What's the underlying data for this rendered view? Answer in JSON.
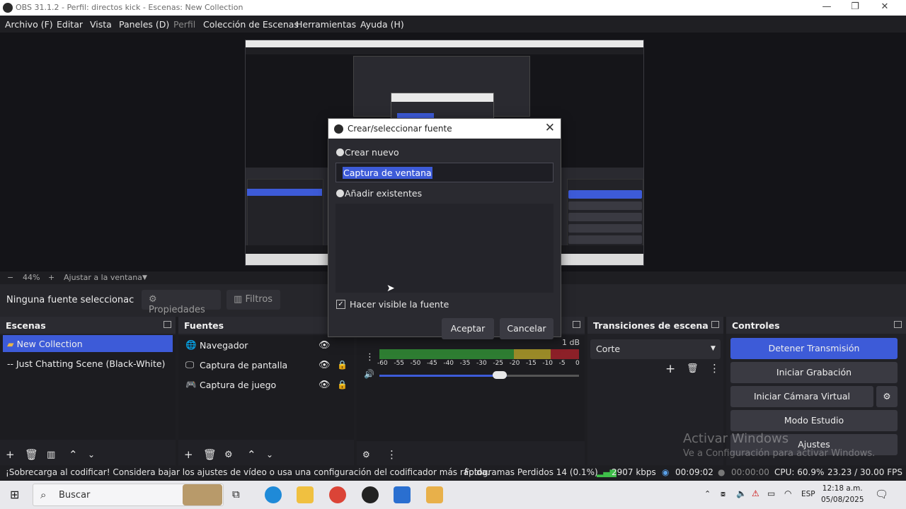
{
  "window": {
    "title": "OBS 31.1.2 - Perfil: directos kick - Escenas: New Collection"
  },
  "menu": [
    "Archivo (F)",
    "Editar",
    "Vista",
    "Paneles (D)",
    "Perfil",
    "Colección de Escenas",
    "Herramientas",
    "Ayuda (H)"
  ],
  "zoom": {
    "minus": "−",
    "value": "44%",
    "plus": "+",
    "fit_label": "Ajustar a la ventana",
    "dropdown": "▼"
  },
  "source_toolbar": {
    "no_selection": "Ninguna fuente seleccionac",
    "properties": "Propiedades",
    "filters": "Filtros"
  },
  "scenes": {
    "title": "Escenas",
    "items": [
      "New Collection",
      "-- Just Chatting Scene (Black-White)"
    ]
  },
  "sources": {
    "title": "Fuentes",
    "items": [
      "Navegador",
      "Captura de pantalla",
      "Captura de juego"
    ]
  },
  "mixer": {
    "db_label": "1 dB",
    "ticks": [
      "-60",
      "-55",
      "-50",
      "-45",
      "-40",
      "-35",
      "-30",
      "-25",
      "-20",
      "-15",
      "-10",
      "-5",
      "0"
    ]
  },
  "transitions": {
    "title": "Transiciones de escena",
    "selected": "Corte"
  },
  "controls": {
    "title": "Controles",
    "stop_stream": "Detener Transmisión",
    "start_recording": "Iniciar Grabación",
    "virtual_cam": "Iniciar Cámara Virtual",
    "studio_mode": "Modo Estudio",
    "settings": "Ajustes"
  },
  "dialog": {
    "title": "Crear/seleccionar fuente",
    "create_new": "Crear nuevo",
    "name_value": "Captura de ventana",
    "add_existing": "Añadir existentes",
    "make_visible": "Hacer visible la fuente",
    "accept": "Aceptar",
    "cancel": "Cancelar"
  },
  "status": {
    "warning": "¡Sobrecarga al codificar! Considera bajar los ajustes de vídeo o usa una configuración del codificador más rápida.",
    "dropped": "Fotogramas Perdidos 14 (0.1%)",
    "bitrate": "2907 kbps",
    "stream_time": "00:09:02",
    "rec_time": "00:00:00",
    "cpu": "CPU: 60.9%",
    "fps": "23.23 / 30.00 FPS"
  },
  "watermark": {
    "line1": "Activar Windows",
    "line2": "Ve a Configuración para activar Windows."
  },
  "taskbar": {
    "search_placeholder": "Buscar",
    "lang": "ESP",
    "time": "12:18 a.m.",
    "date": "05/08/2025"
  },
  "colors": {
    "accent": "#3d5bd8",
    "meter_green": "#2e8b2e",
    "meter_yellow": "#b8a02a",
    "meter_red": "#a8282c"
  }
}
